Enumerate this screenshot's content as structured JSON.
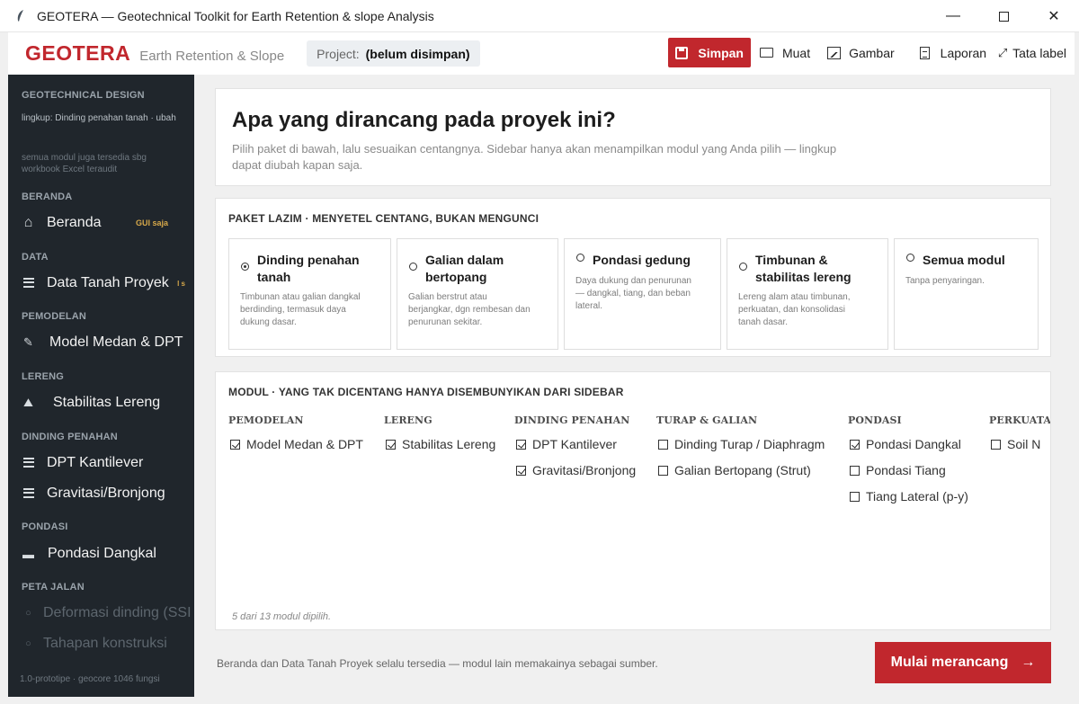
{
  "window": {
    "title": "GEOTERA — Geotechnical Toolkit for Earth Retention & slope Analysis",
    "minimize_glyph": "—",
    "close_glyph": "✕"
  },
  "header": {
    "logo": "GEOTERA",
    "subtitle": "Earth Retention & Slope",
    "project_label": "Project:",
    "project_value": "(belum disimpan)",
    "actions": {
      "save": "Simpan",
      "load": "Muat",
      "image": "Gambar",
      "report": "Laporan",
      "layout": "Tata label",
      "layout_icon_glyph": "⤢"
    }
  },
  "sidebar": {
    "app_section": "GEOTECHNICAL DESIGN",
    "scope_text": "lingkup: Dinding penahan tanah · ubah",
    "workbook_note": "semua modul juga tersedia sbg workbook Excel teraudit",
    "groups": [
      {
        "label": "BERANDA",
        "items": [
          {
            "label": "Beranda",
            "icon": "home-icon",
            "glyph": "⌂",
            "tag": "GUI saja"
          }
        ]
      },
      {
        "label": "DATA",
        "items": [
          {
            "label": "Data Tanah Proyek",
            "icon": "table-icon",
            "tag": "l s"
          }
        ]
      },
      {
        "label": "PEMODELAN",
        "items": [
          {
            "label": "Model Medan & DPT",
            "icon": "pencil-icon",
            "glyph": "✎"
          }
        ]
      },
      {
        "label": "LERENG",
        "items": [
          {
            "label": "Stabilitas Lereng",
            "icon": "slope-icon",
            "glyph": "⛰"
          }
        ]
      },
      {
        "label": "DINDING PENAHAN",
        "items": [
          {
            "label": "DPT Kantilever",
            "icon": "table-icon"
          },
          {
            "label": "Gravitasi/Bronjong",
            "icon": "table-icon"
          }
        ]
      },
      {
        "label": "PONDASI",
        "items": [
          {
            "label": "Pondasi Dangkal",
            "icon": "footing-icon",
            "glyph": "▬"
          }
        ]
      },
      {
        "label": "PETA JALAN",
        "items": [
          {
            "label": "Deformasi dinding (SSI",
            "icon": "dot-icon",
            "glyph": "○"
          },
          {
            "label": "Tahapan konstruksi",
            "icon": "dot-icon",
            "glyph": "○"
          }
        ]
      }
    ],
    "version": "1.0-prototipe · geocore 1046 fungsi"
  },
  "intro": {
    "heading": "Apa yang dirancang pada proyek ini?",
    "description": "Pilih paket di bawah, lalu sesuaikan centangnya. Sidebar hanya akan menampilkan modul yang Anda pilih — lingkup dapat diubah kapan saja."
  },
  "packages": {
    "title": "PAKET LAZIM  ·  MENYETEL CENTANG, BUKAN MENGUNCI",
    "items": [
      {
        "title": "Dinding penahan tanah",
        "desc": "Timbunan atau galian dangkal berdinding, termasuk daya dukung dasar.",
        "selected": true
      },
      {
        "title": "Galian dalam bertopang",
        "desc": "Galian berstrut atau berjangkar, dgn rembesan dan penurunan sekitar.",
        "selected": false
      },
      {
        "title": "Pondasi gedung",
        "desc": "Daya dukung dan penurunan — dangkal, tiang, dan beban lateral.",
        "selected": false
      },
      {
        "title": "Timbunan & stabilitas lereng",
        "desc": "Lereng alam atau timbunan, perkuatan, dan konsolidasi tanah dasar.",
        "selected": false
      },
      {
        "title": "Semua modul",
        "desc": "Tanpa penyaringan.",
        "selected": false
      }
    ]
  },
  "modules": {
    "title": "MODUL  ·  YANG TAK DICENTANG HANYA DISEMBUNYIKAN DARI SIDEBAR",
    "columns": [
      {
        "header": "PEMODELAN",
        "items": [
          {
            "label": "Model Medan & DPT",
            "checked": true
          }
        ]
      },
      {
        "header": "LERENG",
        "items": [
          {
            "label": "Stabilitas Lereng",
            "checked": true
          }
        ]
      },
      {
        "header": "DINDING PENAHAN",
        "items": [
          {
            "label": "DPT Kantilever",
            "checked": true
          },
          {
            "label": "Gravitasi/Bronjong",
            "checked": true
          }
        ]
      },
      {
        "header": "TURAP & GALIAN",
        "items": [
          {
            "label": "Dinding Turap / Diaphragm",
            "checked": false
          },
          {
            "label": "Galian Bertopang (Strut)",
            "checked": false
          }
        ]
      },
      {
        "header": "PONDASI",
        "items": [
          {
            "label": "Pondasi Dangkal",
            "checked": true
          },
          {
            "label": "Pondasi Tiang",
            "checked": false
          },
          {
            "label": "Tiang Lateral (p-y)",
            "checked": false
          }
        ]
      },
      {
        "header": "PERKUATA",
        "items": [
          {
            "label": "Soil N",
            "checked": false
          }
        ]
      }
    ],
    "count_text": "5 dari 13 modul dipilih."
  },
  "footer": {
    "note": "Beranda dan Data Tanah Proyek selalu tersedia — modul lain memakainya sebagai sumber.",
    "start_button": "Mulai merancang",
    "start_arrow": "→"
  }
}
